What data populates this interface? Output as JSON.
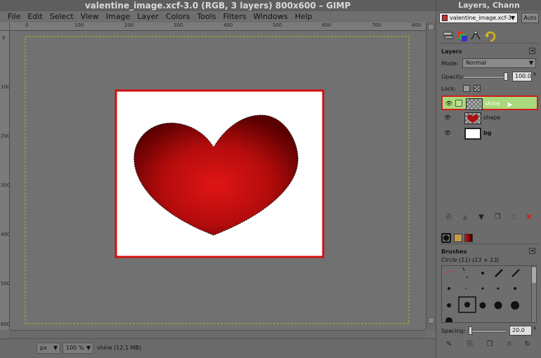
{
  "window": {
    "title": "valentine_image.xcf-3.0 (RGB, 3 layers) 800x600 – GIMP"
  },
  "menu": [
    "File",
    "Edit",
    "Select",
    "View",
    "Image",
    "Layer",
    "Colors",
    "Tools",
    "Filters",
    "Windows",
    "Help"
  ],
  "rulers": {
    "h_ticks": [
      "0",
      "100",
      "200",
      "300",
      "400",
      "500",
      "600",
      "700",
      "800"
    ],
    "v_ticks": [
      "0",
      "100",
      "200",
      "300",
      "400",
      "500",
      "600"
    ]
  },
  "status": {
    "unit": "px",
    "zoom": "100 %",
    "info": "shine (12.1 MB)"
  },
  "dock": {
    "title": "Layers, Chann",
    "image_selector": "valentine_image.xcf-3",
    "auto_label": "Auto",
    "layers_title": "Layers",
    "mode_label": "Mode:",
    "mode_value": "Normal",
    "opacity_label": "Opacity:",
    "opacity_value": "100.0",
    "lock_label": "Lock:",
    "layers": [
      {
        "name": "shine",
        "selected": true
      },
      {
        "name": "shape",
        "selected": false
      },
      {
        "name": "bg",
        "selected": false
      }
    ],
    "brushes_title": "Brushes",
    "brush_name": "Circle (11) (13 × 13)",
    "spacing_label": "Spacing:",
    "spacing_value": "20.0"
  },
  "colors": {
    "selection_border": "#d31b1b",
    "heart_center": "#e01515",
    "heart_edge": "#6b0000",
    "layer_selected_bg": "#a9d97a"
  }
}
